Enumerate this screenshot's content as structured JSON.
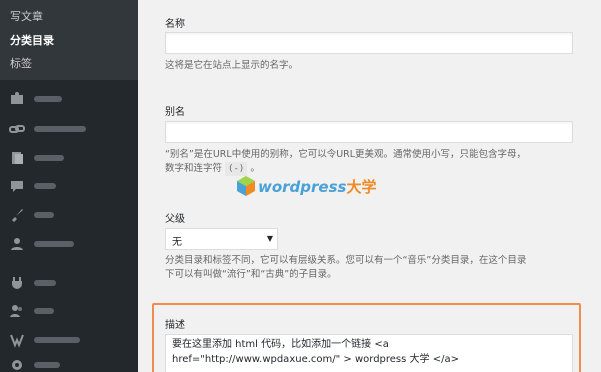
{
  "sidebar": {
    "submenu": [
      {
        "label": "写文章",
        "current": false
      },
      {
        "label": "分类目录",
        "current": true
      },
      {
        "label": "标签",
        "current": false
      }
    ],
    "menu_icons": [
      "media-icon",
      "links-icon",
      "pages-icon",
      "comments-icon",
      "appearance-icon",
      "contact-icon",
      "plugins-icon",
      "users-icon",
      "tools-icon",
      "snippets-icon",
      "settings-icon"
    ]
  },
  "form": {
    "name": {
      "label": "名称",
      "value": "",
      "hint": "这将是它在站点上显示的名字。"
    },
    "slug": {
      "label": "别名",
      "value": "",
      "hint_line1": "“别名”是在URL中使用的别称，它可以令URL更美观。通常使用小写，只能包含字母，",
      "hint_line2_prefix": "数字和连字符",
      "hint_code": "(-)",
      "hint_line2_suffix": "。"
    },
    "parent": {
      "label": "父级",
      "selected": "无",
      "hint_line1": "分类目录和标签不同，它可以有层级关系。您可以有一个“音乐”分类目录，在这个目录",
      "hint_line2": "下可以有叫做“流行”和“古典”的子目录。"
    },
    "description": {
      "label": "描述",
      "line1": "要在这里添加 html 代码，比如添加一个链接 <a",
      "line2": "href=\"http://www.wpdaxue.com/\" > wordpress 大学 </a>"
    }
  },
  "watermark": {
    "text_latin": "wordpress",
    "text_cn": "大学"
  },
  "colors": {
    "sidebar_bg": "#23282d",
    "submenu_bg": "#32373c",
    "highlight_border": "#ee8d4e",
    "page_bg": "#f1f1f1"
  }
}
